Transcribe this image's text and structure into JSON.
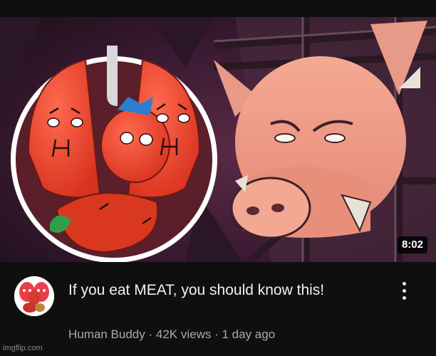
{
  "video": {
    "duration": "8:02",
    "title": "If you eat MEAT, you should know this!",
    "channel": "Human Buddy",
    "separator": "·",
    "views": "42K views",
    "age": "1 day ago"
  },
  "colors": {
    "background": "#0f0f0f",
    "title_text": "#f1f1f1",
    "meta_text": "#aaaaaa",
    "duration_badge": "#000000"
  },
  "icons": {
    "menu": "more-vert-icon"
  },
  "watermark": "imgflip.com"
}
